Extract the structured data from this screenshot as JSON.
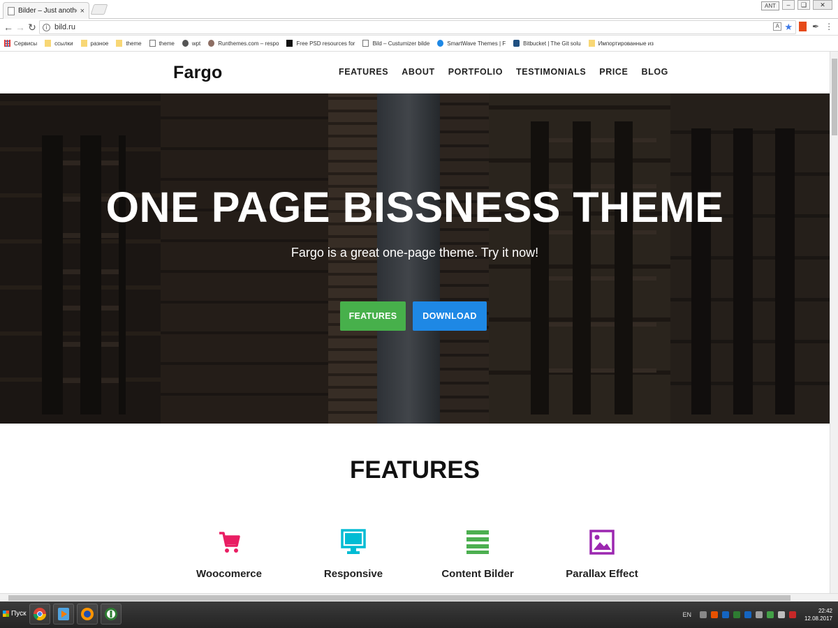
{
  "browser": {
    "tab_title": "Bilder – Just another Word",
    "tab_close": "×",
    "window_user": "ANT",
    "address": "bild.ru",
    "bookmarks": [
      {
        "label": "Сервисы",
        "icon": "apps-icon"
      },
      {
        "label": "ссылки",
        "icon": "folder-icon"
      },
      {
        "label": "разное",
        "icon": "folder-icon"
      },
      {
        "label": "theme",
        "icon": "folder-icon"
      },
      {
        "label": "theme",
        "icon": "page-icon"
      },
      {
        "label": "wpt",
        "icon": "wordpress-icon"
      },
      {
        "label": "Runthemes.com – respo",
        "icon": "runthemes-icon"
      },
      {
        "label": "Free PSD resources for",
        "icon": "freepsd-icon"
      },
      {
        "label": "Bild – Custumizer bilde",
        "icon": "page-icon"
      },
      {
        "label": "SmartWave Themes | F",
        "icon": "smartwave-icon"
      },
      {
        "label": "Bitbucket | The Git solu",
        "icon": "bitbucket-icon"
      },
      {
        "label": "Импортированные из",
        "icon": "folder-icon"
      }
    ]
  },
  "site": {
    "logo": "Fargo",
    "nav": [
      "FEATURES",
      "ABOUT",
      "PORTFOLIO",
      "TESTIMONIALS",
      "PRICE",
      "BLOG"
    ],
    "hero": {
      "title": "ONE PAGE BISSNESS THEME",
      "subtitle": "Fargo is a great one-page theme. Try it now!",
      "primary_button": "FEATURES",
      "secondary_button": "DOWNLOAD"
    },
    "features": {
      "title": "FEATURES",
      "items": [
        {
          "label": "Woocomerce",
          "icon": "shopping-cart-icon",
          "color": "#e91e63"
        },
        {
          "label": "Responsive",
          "icon": "monitor-icon",
          "color": "#00bcd4"
        },
        {
          "label": "Content Bilder",
          "icon": "list-lines-icon",
          "color": "#4caf50"
        },
        {
          "label": "Parallax Effect",
          "icon": "image-icon",
          "color": "#9c27b0"
        }
      ]
    }
  },
  "taskbar": {
    "start_label": "Пуск",
    "language": "EN",
    "time": "22:42",
    "date": "12.08.2017"
  },
  "colors": {
    "green_button": "#47b04b",
    "blue_button": "#1e88e5"
  }
}
